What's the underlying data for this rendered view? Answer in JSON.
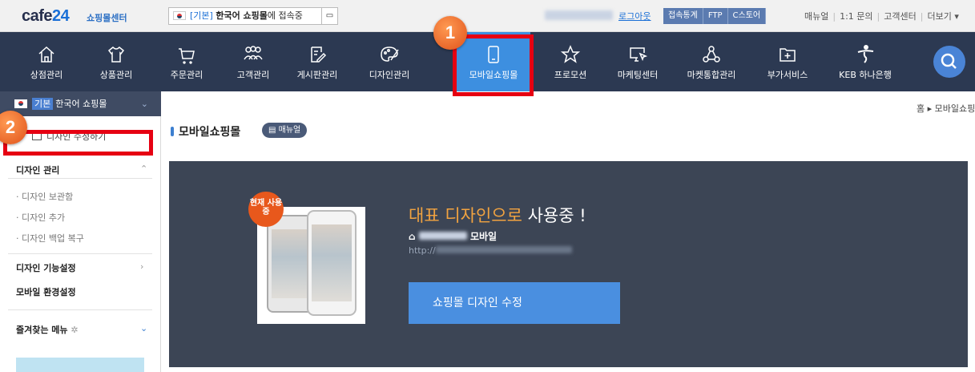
{
  "topbar": {
    "logo_brand": "cafe",
    "logo_num": "24",
    "logo_sub": "쇼핑몰센터",
    "shop_select": {
      "tag": "[기본]",
      "name": "한국어 쇼핑몰",
      "suffix": "에 접속중"
    },
    "logout": "로그아웃",
    "buttons": [
      "접속통계",
      "FTP",
      "C스토어"
    ],
    "links": [
      "매뉴얼",
      "1:1 문의",
      "고객센터",
      "더보기 ▾"
    ]
  },
  "nav": [
    {
      "label": "상점관리",
      "icon": "home-icon"
    },
    {
      "label": "상품관리",
      "icon": "shirt-icon"
    },
    {
      "label": "주문관리",
      "icon": "cart-icon"
    },
    {
      "label": "고객관리",
      "icon": "users-icon"
    },
    {
      "label": "게시판관리",
      "icon": "board-icon"
    },
    {
      "label": "디자인관리",
      "icon": "palette-icon"
    },
    {
      "label": "모바일쇼핑몰",
      "icon": "mobile-icon"
    },
    {
      "label": "프로모션",
      "icon": "star-icon"
    },
    {
      "label": "마케팅센터",
      "icon": "monitor-icon"
    },
    {
      "label": "마켓통합관리",
      "icon": "network-icon"
    },
    {
      "label": "부가서비스",
      "icon": "plus-folder-icon"
    },
    {
      "label": "KEB 하나은행",
      "icon": "bank-icon"
    }
  ],
  "annotations": {
    "step1": "1",
    "step2": "2"
  },
  "sidebar": {
    "shop_tag": "기본",
    "shop_name": "한국어 쇼핑몰",
    "edit_design": "디자인 수정하기",
    "section_design": "디자인 관리",
    "sub_items": [
      "· 디자인 보관함",
      "· 디자인 추가",
      "· 디자인 백업 복구"
    ],
    "section_function": "디자인 기능설정",
    "section_env": "모바일 환경설정",
    "favorites": "즐겨찾는 메뉴"
  },
  "main": {
    "breadcrumb": "홈 ▸ 모바일쇼핑몰",
    "title": "모바일쇼핑몰",
    "manual_button": "매뉴얼",
    "current_badge": "현재 사용중",
    "headline_highlight": "대표 디자인으로",
    "headline_rest": " 사용중 !",
    "home_label": "모바일",
    "url_prefix": "http://",
    "edit_button": "쇼핑몰 디자인 수정"
  },
  "colors": {
    "nav_bg": "#2c3952",
    "active": "#3d8fe0",
    "highlight": "#e60012",
    "accent": "#f2a340"
  }
}
